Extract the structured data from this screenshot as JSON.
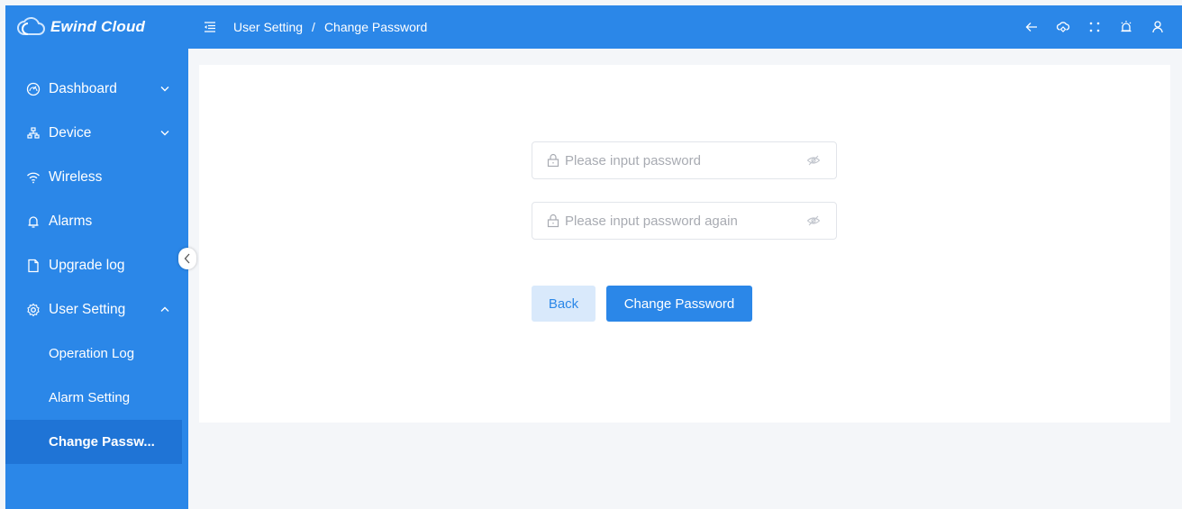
{
  "app": {
    "name": "Ewind Cloud"
  },
  "header": {
    "breadcrumb": [
      "User Setting",
      "Change Password"
    ],
    "breadcrumb_separator": "/",
    "icons": [
      "back-arrow-icon",
      "cloud-icon",
      "fullscreen-icon",
      "alarm-icon",
      "user-icon"
    ]
  },
  "sidebar": {
    "items": [
      {
        "label": "Dashboard",
        "icon": "dashboard-icon",
        "caret": "down"
      },
      {
        "label": "Device",
        "icon": "device-icon",
        "caret": "down"
      },
      {
        "label": "Wireless",
        "icon": "wifi-icon"
      },
      {
        "label": "Alarms",
        "icon": "bell-icon"
      },
      {
        "label": "Upgrade log",
        "icon": "document-icon"
      },
      {
        "label": "User Setting",
        "icon": "gear-icon",
        "caret": "up"
      }
    ],
    "subitems": [
      {
        "label": "Operation Log"
      },
      {
        "label": "Alarm Setting"
      },
      {
        "label": "Change Passw..."
      }
    ],
    "active": "Change Passw..."
  },
  "form": {
    "password": {
      "placeholder": "Please input password",
      "value": ""
    },
    "password_again": {
      "placeholder": "Please input password again",
      "value": ""
    },
    "back_label": "Back",
    "submit_label": "Change Password"
  },
  "colors": {
    "primary": "#2b87e8",
    "active_bg": "#1f74d6",
    "page_bg": "#f4f6f9",
    "back_btn_bg": "#d9e9fb"
  }
}
